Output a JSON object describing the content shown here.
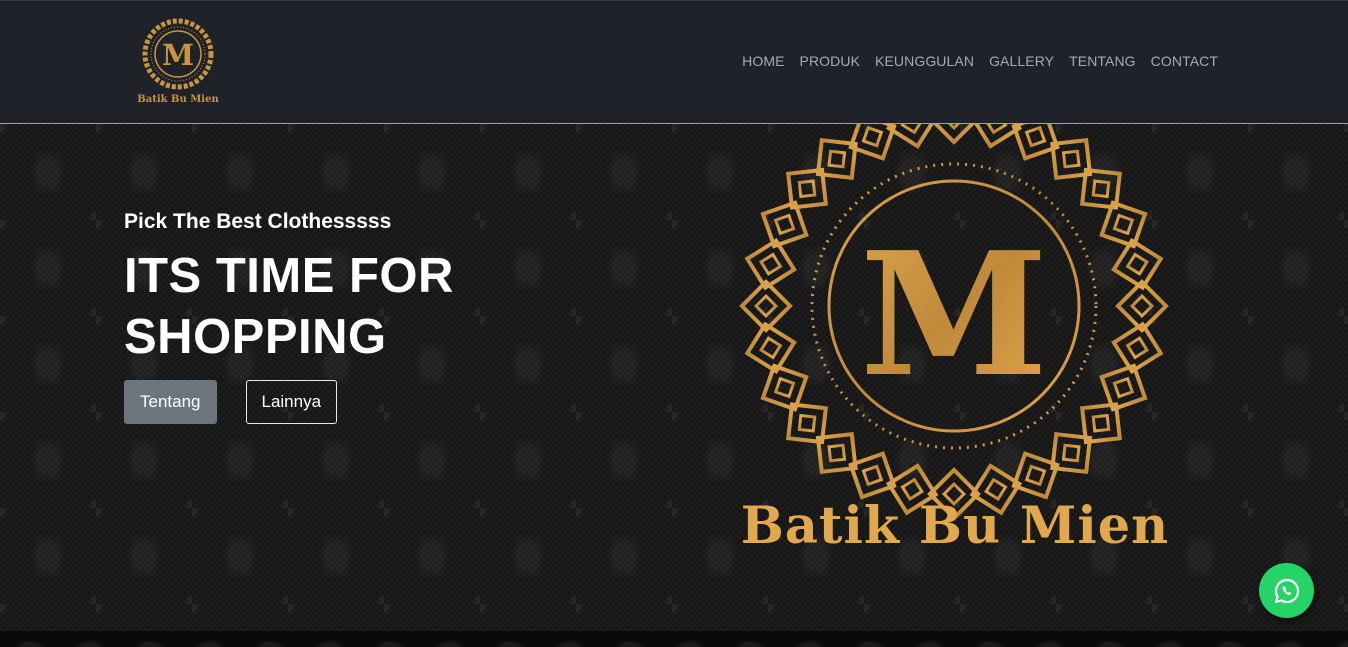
{
  "navbar": {
    "brand_name": "Batik Bu Mien",
    "brand_letter": "M",
    "links": [
      {
        "label": "HOME"
      },
      {
        "label": "PRODUK"
      },
      {
        "label": "KEUNGGULAN"
      },
      {
        "label": "GALLERY"
      },
      {
        "label": "TENTANG"
      },
      {
        "label": "CONTACT"
      }
    ]
  },
  "hero": {
    "tagline": "Pick The Best Clothesssss",
    "headline_line1": "ITS TIME FOR",
    "headline_line2": "SHOPPING",
    "primary_button": "Tentang",
    "secondary_button": "Lainnya",
    "logo_letter": "M",
    "logo_text": "Batik Bu Mien"
  },
  "floating": {
    "whatsapp_icon": "whatsapp-icon"
  },
  "colors": {
    "gold": "#c9963f",
    "gold_light": "#e2a84d",
    "navbar_bg": "#1f2228",
    "whatsapp": "#25d366"
  }
}
